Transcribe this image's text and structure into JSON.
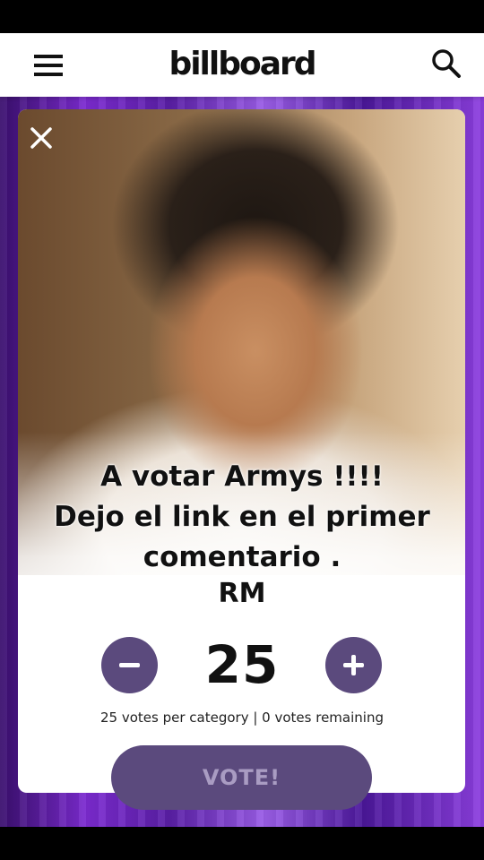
{
  "header": {
    "logo_text": "billboard",
    "menu_icon": "hamburger-menu-icon",
    "search_icon": "search-icon"
  },
  "card": {
    "close_icon": "close-icon",
    "caption_lines": [
      "A votar Armys !!!!",
      "Dejo el link en el primer",
      "comentario ."
    ],
    "artist_name": "RM"
  },
  "voting": {
    "count": "25",
    "decrement_icon": "minus-icon",
    "increment_icon": "plus-icon",
    "info": "25 votes per category | 0 votes remaining",
    "vote_label": "VOTE!"
  },
  "colors": {
    "accent": "#5b4a7d",
    "vote_label": "#a99cc2",
    "background_band": "#7c2bd1"
  }
}
